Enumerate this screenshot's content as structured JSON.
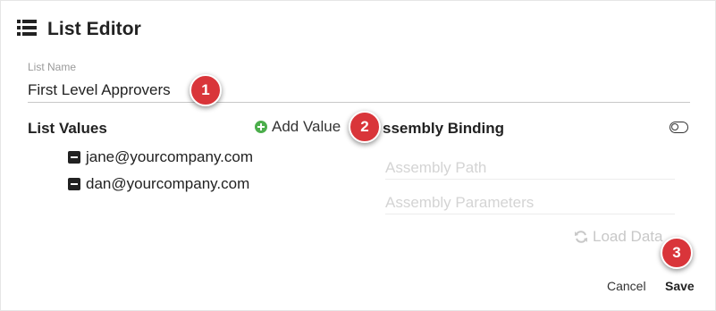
{
  "dialog": {
    "title": "List Editor",
    "icon": "list-icon"
  },
  "list_name": {
    "label": "List Name",
    "value": "First Level Approvers"
  },
  "list_values": {
    "title": "List Values",
    "add_label": "Add Value",
    "items": [
      {
        "email": "jane@yourcompany.com"
      },
      {
        "email": "dan@yourcompany.com"
      }
    ]
  },
  "assembly_binding": {
    "title": "ssembly Binding",
    "path_placeholder": "Assembly Path",
    "params_placeholder": "Assembly Parameters",
    "load_label": "Load Data"
  },
  "footer": {
    "cancel_label": "Cancel",
    "save_label": "Save"
  },
  "callouts": [
    "1",
    "2",
    "3"
  ],
  "colors": {
    "accent_green": "#4cae4c",
    "callout_red": "#d9353a"
  }
}
